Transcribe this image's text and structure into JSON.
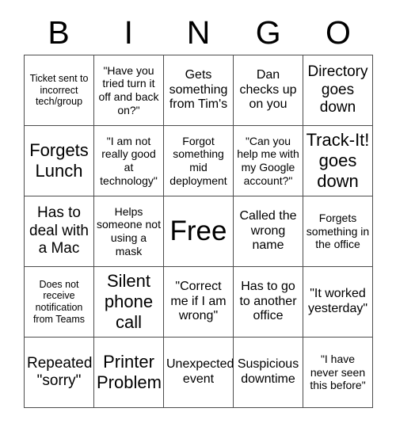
{
  "card": {
    "title": "BINGO",
    "header_letters": [
      "B",
      "I",
      "N",
      "G",
      "O"
    ],
    "columns": 5,
    "rows": 5,
    "free_space": {
      "label": "Free",
      "row": 3,
      "column": 3
    },
    "colors": {
      "text": "#000000",
      "background": "#ffffff",
      "grid_line": "#4d4d4d"
    },
    "cells": [
      {
        "id": "b1",
        "column": "B",
        "row": 1,
        "text": "Ticket sent to incorrect tech/group",
        "size": "xs"
      },
      {
        "id": "i1",
        "column": "I",
        "row": 1,
        "text": "\"Have you tried turn it off and back on?\"",
        "size": "sm"
      },
      {
        "id": "n1",
        "column": "N",
        "row": 1,
        "text": "Gets something from Tim's",
        "size": "md"
      },
      {
        "id": "g1",
        "column": "G",
        "row": 1,
        "text": "Dan checks up on you",
        "size": "md"
      },
      {
        "id": "o1",
        "column": "O",
        "row": 1,
        "text": "Directory goes down",
        "size": "lg"
      },
      {
        "id": "b2",
        "column": "B",
        "row": 2,
        "text": "Forgets Lunch",
        "size": "xl"
      },
      {
        "id": "i2",
        "column": "I",
        "row": 2,
        "text": "\"I am not really good at technology\"",
        "size": "sm"
      },
      {
        "id": "n2",
        "column": "N",
        "row": 2,
        "text": "Forgot something mid deployment",
        "size": "sm"
      },
      {
        "id": "g2",
        "column": "G",
        "row": 2,
        "text": "\"Can you help me with my Google account?\"",
        "size": "sm"
      },
      {
        "id": "o2",
        "column": "O",
        "row": 2,
        "text": "Track-It! goes down",
        "size": "xl"
      },
      {
        "id": "b3",
        "column": "B",
        "row": 3,
        "text": "Has to deal with a Mac",
        "size": "lg"
      },
      {
        "id": "i3",
        "column": "I",
        "row": 3,
        "text": "Helps someone not using a mask",
        "size": "sm"
      },
      {
        "id": "n3",
        "column": "N",
        "row": 3,
        "text": "Free",
        "size": "free"
      },
      {
        "id": "g3",
        "column": "G",
        "row": 3,
        "text": "Called the wrong name",
        "size": "md"
      },
      {
        "id": "o3",
        "column": "O",
        "row": 3,
        "text": "Forgets something in the office",
        "size": "sm"
      },
      {
        "id": "b4",
        "column": "B",
        "row": 4,
        "text": "Does not receive notification from Teams",
        "size": "xs"
      },
      {
        "id": "i4",
        "column": "I",
        "row": 4,
        "text": "Silent phone call",
        "size": "xl"
      },
      {
        "id": "n4",
        "column": "N",
        "row": 4,
        "text": "\"Correct me if I am wrong\"",
        "size": "md"
      },
      {
        "id": "g4",
        "column": "G",
        "row": 4,
        "text": "Has to go to another office",
        "size": "md"
      },
      {
        "id": "o4",
        "column": "O",
        "row": 4,
        "text": "\"It worked yesterday\"",
        "size": "md"
      },
      {
        "id": "b5",
        "column": "B",
        "row": 5,
        "text": "Repeated \"sorry\"",
        "size": "lg"
      },
      {
        "id": "i5",
        "column": "I",
        "row": 5,
        "text": "Printer Problem",
        "size": "xl"
      },
      {
        "id": "n5",
        "column": "N",
        "row": 5,
        "text": "Unexpected event",
        "size": "md"
      },
      {
        "id": "g5",
        "column": "G",
        "row": 5,
        "text": "Suspicious downtime",
        "size": "md"
      },
      {
        "id": "o5",
        "column": "O",
        "row": 5,
        "text": "\"I have never seen this before\"",
        "size": "sm"
      }
    ]
  }
}
